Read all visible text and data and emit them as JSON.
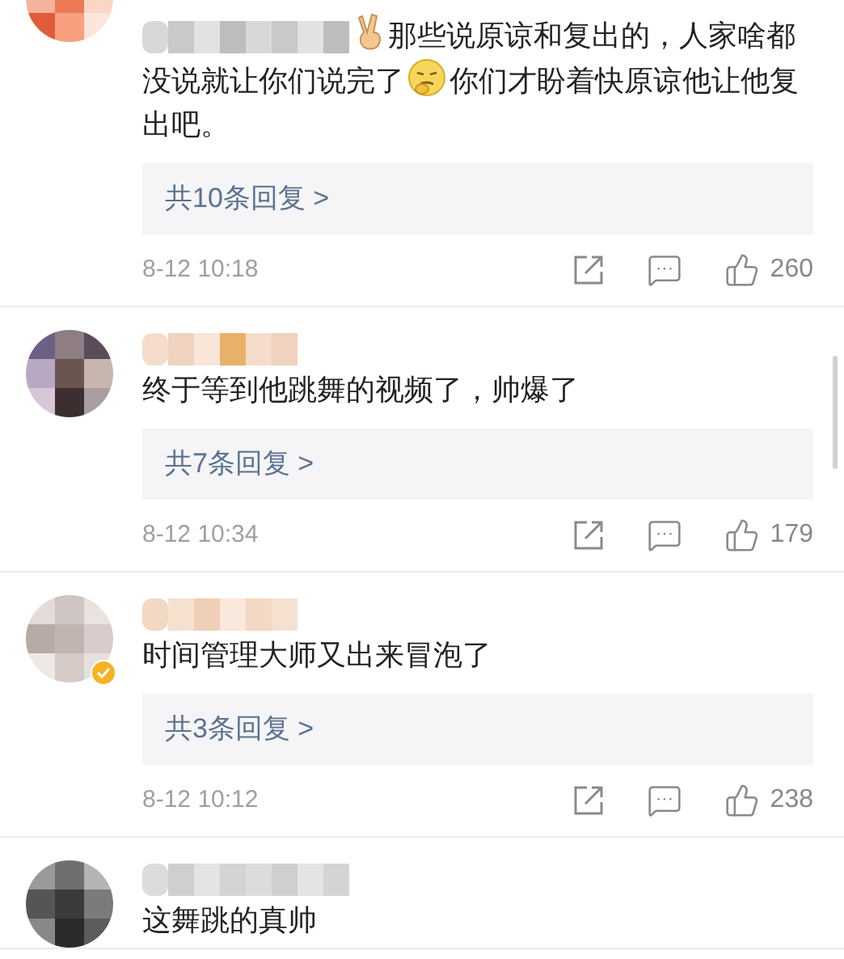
{
  "comments": [
    {
      "verified": false,
      "segments": [
        {
          "kind": "blur"
        },
        {
          "kind": "hand"
        },
        {
          "kind": "text",
          "text": "那些说原谅和复出的，人家啥都没说就让你们说完了"
        },
        {
          "kind": "face"
        },
        {
          "kind": "text",
          "text": "你们才盼着快原谅他让他复出吧。"
        }
      ],
      "replies": "共10条回复 >",
      "time": "8-12 10:18",
      "likes": "260"
    },
    {
      "verified": false,
      "segments": [
        {
          "kind": "text",
          "text": "终于等到他跳舞的视频了，帅爆了"
        }
      ],
      "replies": "共7条回复 >",
      "time": "8-12 10:34",
      "likes": "179"
    },
    {
      "verified": true,
      "segments": [
        {
          "kind": "text",
          "text": "时间管理大师又出来冒泡了"
        }
      ],
      "replies": "共3条回复 >",
      "time": "8-12 10:12",
      "likes": "238"
    },
    {
      "verified": false,
      "segments": [
        {
          "kind": "text",
          "text": "这舞跳的真帅"
        }
      ]
    }
  ]
}
